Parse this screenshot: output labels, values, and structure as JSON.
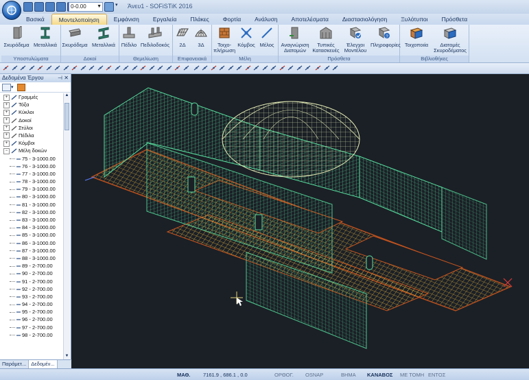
{
  "title": {
    "combo_value": "0-0.00",
    "window_title": "Άνευ1 - SOFiSTiK 2016"
  },
  "tabs": [
    {
      "label": "Βασικά",
      "active": false
    },
    {
      "label": "Μοντελοποίηση",
      "active": true
    },
    {
      "label": "Εμφάνιση",
      "active": false
    },
    {
      "label": "Εργαλεία",
      "active": false
    },
    {
      "label": "Πλάκες",
      "active": false
    },
    {
      "label": "Φορτία",
      "active": false
    },
    {
      "label": "Ανάλυση",
      "active": false
    },
    {
      "label": "Αποτελέσματα",
      "active": false
    },
    {
      "label": "Διαστασιολόγηση",
      "active": false
    },
    {
      "label": "Ξυλότυποι",
      "active": false
    },
    {
      "label": "Πρόσθετα",
      "active": false
    }
  ],
  "ribbon": {
    "groups": [
      {
        "label": "Υποστυλώματα",
        "buttons": [
          "Σκυρόδεμα",
          "Μεταλλικά"
        ]
      },
      {
        "label": "Δοκοί",
        "buttons": [
          "Σκυρόδεμα",
          "Μεταλλικά"
        ]
      },
      {
        "label": "Θεμελίωση",
        "buttons": [
          "Πέδιλο",
          "Πεδιλοδοκός"
        ]
      },
      {
        "label": "Επιφανειακά",
        "buttons": [
          "2Δ",
          "3Δ"
        ]
      },
      {
        "label": "Μέλη",
        "buttons": [
          "Τοιχο-πλήρωση",
          "Κόμβος",
          "Μέλος"
        ]
      },
      {
        "label": "Πρόσθετα",
        "buttons": [
          "Αναγνώριση Διατομών",
          "Τυπικές Κατασκευές",
          "Έλεγχοι Μοντέλου",
          "Πληροφορίες"
        ]
      },
      {
        "label": "Βιβλιοθήκες",
        "buttons": [
          "Τοιχοποιία",
          "Διατομές Σκυροδέματος"
        ]
      }
    ]
  },
  "sidebar": {
    "title": "Δεδομένα Έργου",
    "tree": [
      {
        "label": "Γραμμές",
        "type": "group",
        "icon": "line-icon"
      },
      {
        "label": "Τόξα",
        "type": "group",
        "icon": "arc-icon"
      },
      {
        "label": "Κύκλοι",
        "type": "group",
        "icon": "circle-icon"
      },
      {
        "label": "Δοκοί",
        "type": "group",
        "icon": "beam-icon"
      },
      {
        "label": "Στύλοι",
        "type": "group",
        "icon": "column-icon"
      },
      {
        "label": "Πέδιλα",
        "type": "group",
        "icon": "footing-icon"
      },
      {
        "label": "Κόμβοι",
        "type": "group",
        "icon": "node-icon"
      },
      {
        "label": "Μέλη δοκών",
        "type": "group",
        "icon": "member-icon"
      },
      {
        "label": "75 - 3-1000.00",
        "type": "child"
      },
      {
        "label": "76 - 3-1000.00",
        "type": "child"
      },
      {
        "label": "77 - 3-1000.00",
        "type": "child"
      },
      {
        "label": "78 - 3-1000.00",
        "type": "child"
      },
      {
        "label": "79 - 3-1000.00",
        "type": "child"
      },
      {
        "label": "80 - 3-1000.00",
        "type": "child"
      },
      {
        "label": "81 - 3-1000.00",
        "type": "child"
      },
      {
        "label": "82 - 3-1000.00",
        "type": "child"
      },
      {
        "label": "83 - 3-1000.00",
        "type": "child"
      },
      {
        "label": "84 - 3-1000.00",
        "type": "child"
      },
      {
        "label": "85 - 3-1000.00",
        "type": "child"
      },
      {
        "label": "86 - 3-1000.00",
        "type": "child"
      },
      {
        "label": "87 - 3-1000.00",
        "type": "child"
      },
      {
        "label": "88 - 3-1000.00",
        "type": "child"
      },
      {
        "label": "89 - 2-700.00",
        "type": "child"
      },
      {
        "label": "90 - 2-700.00",
        "type": "child"
      },
      {
        "label": "91 - 2-700.00",
        "type": "child"
      },
      {
        "label": "92 - 2-700.00",
        "type": "child"
      },
      {
        "label": "93 - 2-700.00",
        "type": "child"
      },
      {
        "label": "94 - 2-700.00",
        "type": "child"
      },
      {
        "label": "95 - 2-700.00",
        "type": "child"
      },
      {
        "label": "96 - 2-700.00",
        "type": "child"
      },
      {
        "label": "97 - 2-700.00",
        "type": "child"
      },
      {
        "label": "98 - 2-700.00",
        "type": "child"
      }
    ],
    "bottom_tabs": [
      "Παράμετ...",
      "Δεδομέν..."
    ]
  },
  "status": {
    "mode": "ΜΑΘ.",
    "coords": "7161.9 , 686.1 , 0.0",
    "toggles": [
      {
        "label": "ΟΡΘΟΓ.",
        "on": false
      },
      {
        "label": "OSNAP",
        "on": false
      },
      {
        "label": "ΒΗΜΑ",
        "on": false
      },
      {
        "label": "ΚΑΝΑΒΟΣ",
        "on": true
      },
      {
        "label": "ΜΕ ΤΟΜΗ",
        "on": false
      },
      {
        "label": "ΕΝΤΟΣ",
        "on": false
      }
    ]
  },
  "colors": {
    "viewport_bg": "#1b2026",
    "wall_mesh": "#58e0a0",
    "foundation_mesh": "#e8b23a",
    "foundation_edge": "#c8551e",
    "dome_mesh": "#e8f0b8"
  }
}
